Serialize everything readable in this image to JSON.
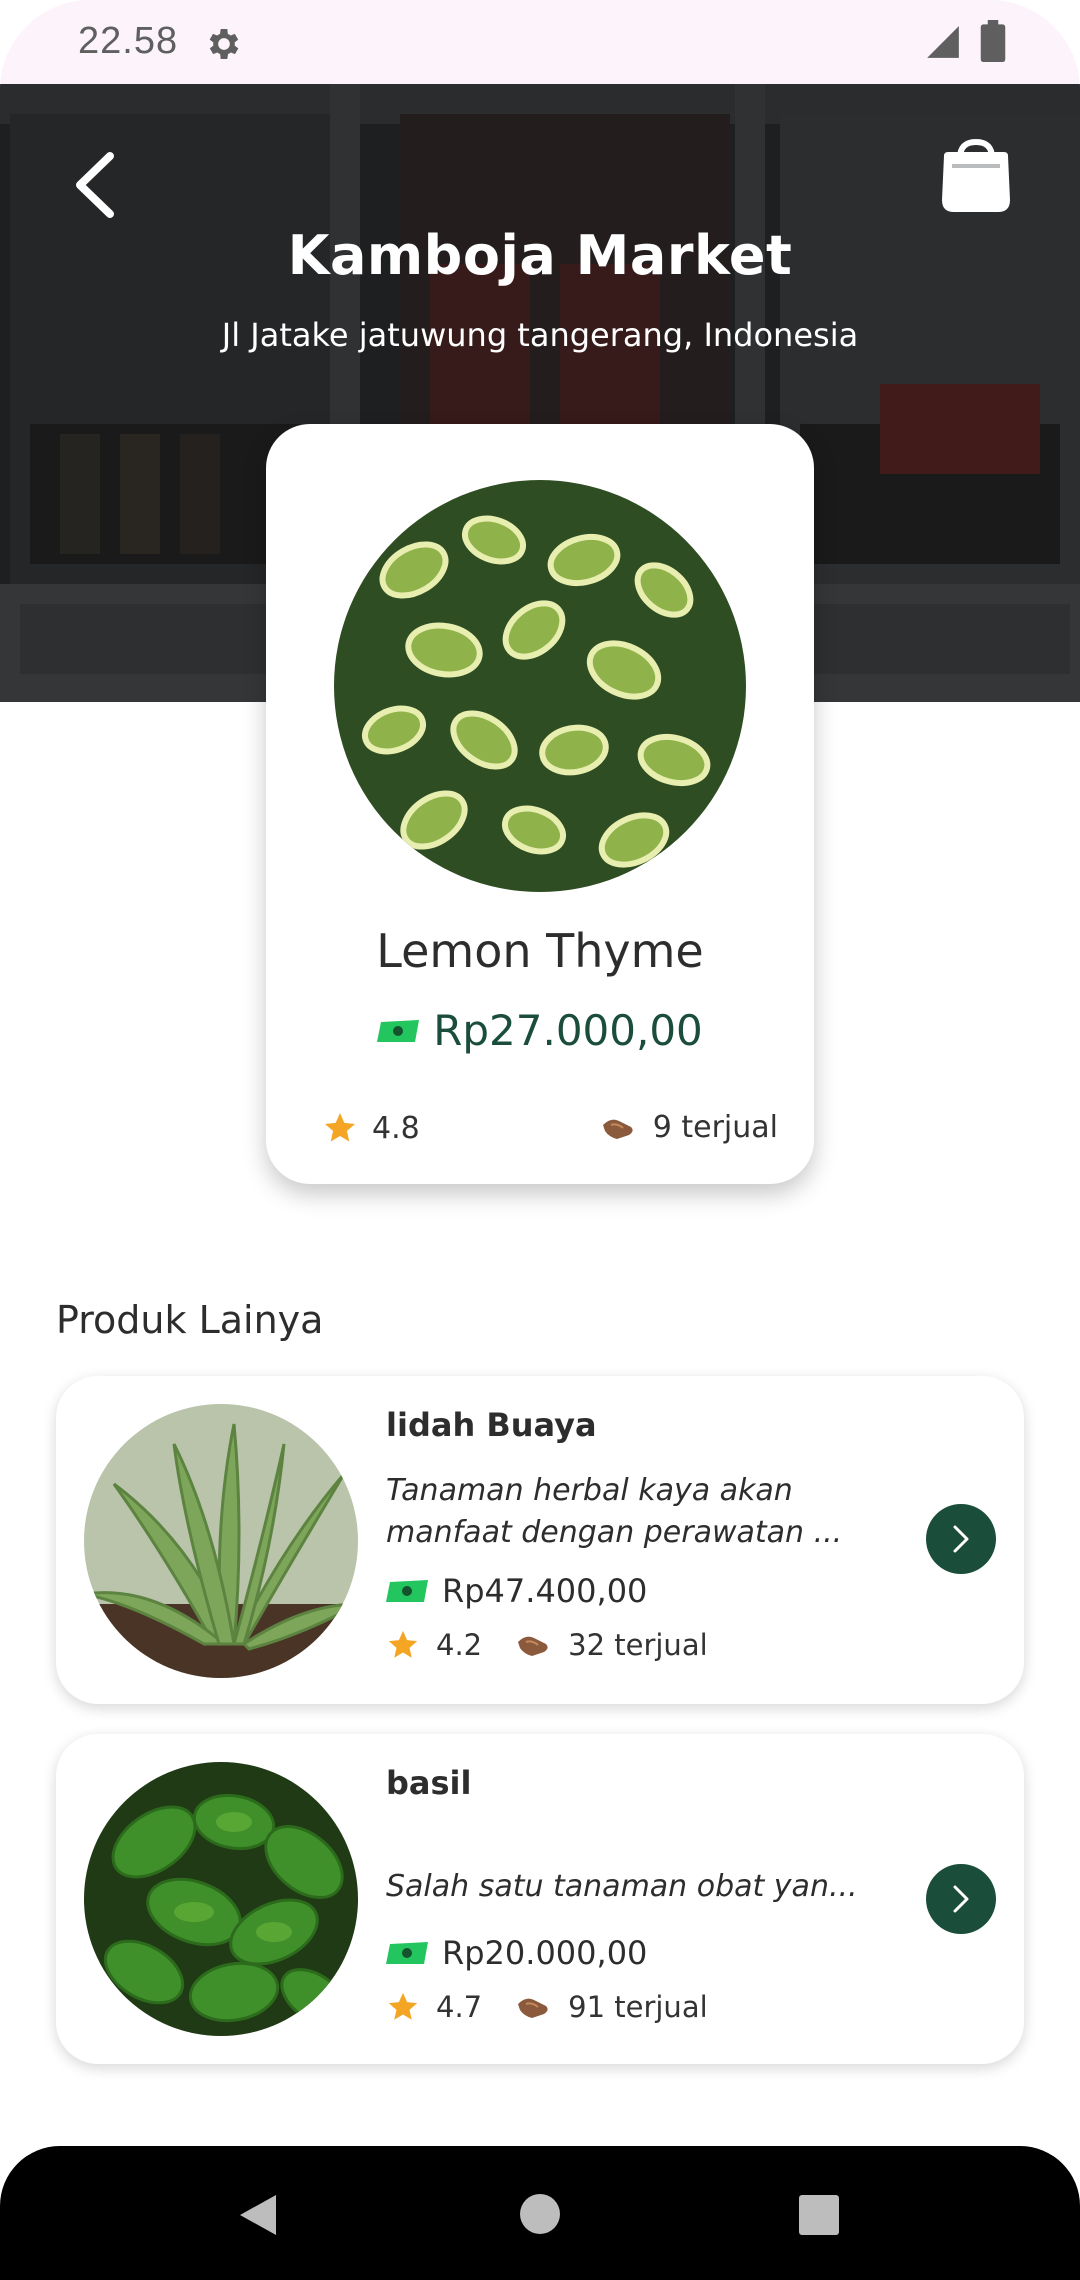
{
  "status_bar": {
    "time": "22.58"
  },
  "header": {
    "title": "Kamboja Market",
    "address": "Jl Jatake jatuwung tangerang, Indonesia"
  },
  "featured": {
    "name": "Lemon Thyme",
    "price": "Rp27.000,00",
    "rating": "4.8",
    "sold": "9 terjual"
  },
  "section": {
    "title": "Produk Lainya"
  },
  "products": [
    {
      "name": "lidah Buaya",
      "description": "Tanaman herbal kaya akan manfaat dengan perawatan ...",
      "price": "Rp47.400,00",
      "rating": "4.2",
      "sold": "32 terjual"
    },
    {
      "name": "basil",
      "description": "Salah satu tanaman obat yan...",
      "price": "Rp20.000,00",
      "rating": "4.7",
      "sold": "91 terjual"
    }
  ],
  "colors": {
    "accent": "#1b4d3b",
    "star": "#f5a524",
    "money": "#22c55e",
    "status_bar_bg": "#fcf3fb"
  },
  "icons": {
    "back": "chevron-left-icon",
    "bag": "shopping-bag-icon",
    "money": "banknote-icon",
    "star": "star-icon",
    "sold": "handshake-icon",
    "go": "chevron-right-icon"
  }
}
